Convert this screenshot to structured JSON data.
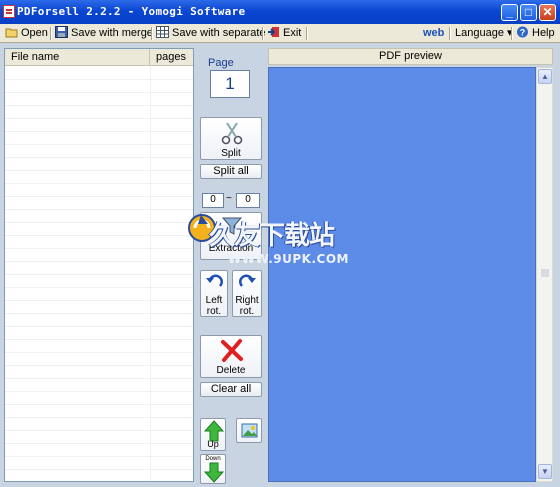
{
  "window": {
    "title": "PDForsell 2.2.2 - Yomogi Software",
    "controls": {
      "minimize": "_",
      "maximize": "□",
      "close": "✕"
    }
  },
  "menu": {
    "open": "Open",
    "save_merge": "Save with merge",
    "save_separate": "Save with separate",
    "exit": "Exit",
    "web": "web",
    "language": "Language",
    "language_arrow": "▾",
    "help": "Help"
  },
  "file_list": {
    "col_name": "File name",
    "col_pages": "pages",
    "rows": []
  },
  "page": {
    "label": "Page",
    "value": "1"
  },
  "buttons": {
    "split": "Split",
    "split_all": "Split all",
    "range_from": "0",
    "range_sep": "~",
    "range_to": "0",
    "extraction": "Extraction",
    "left_rot_1": "Left",
    "left_rot_2": "rot.",
    "right_rot_1": "Right",
    "right_rot_2": "rot.",
    "delete": "Delete",
    "clear_all": "Clear all",
    "up": "Up",
    "down": "Down"
  },
  "preview": {
    "header": "PDF preview"
  },
  "watermark": {
    "text": "久友下载站",
    "url": "WWW.9UPK.COM"
  },
  "colors": {
    "title_bar": "#0a46d2",
    "preview_bg": "#5d8be8",
    "panel_bg": "#c9d4e3",
    "web_link": "#1f4fb8"
  }
}
